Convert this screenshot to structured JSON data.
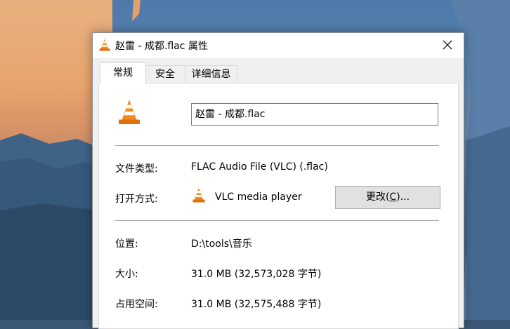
{
  "window": {
    "title": "赵雷 - 成都.flac 属性",
    "close_glyph": "✕"
  },
  "tabs": [
    {
      "label": "常规",
      "active": true
    },
    {
      "label": "安全",
      "active": false
    },
    {
      "label": "详细信息",
      "active": false
    }
  ],
  "general": {
    "file_name": "赵雷 - 成都.flac",
    "file_type_label": "文件类型:",
    "file_type_value": "FLAC Audio File (VLC) (.flac)",
    "opens_with_label": "打开方式:",
    "opens_with_value": "VLC media player",
    "change_button": {
      "before": "更改(",
      "hotkey": "C",
      "after": ")..."
    },
    "location_label": "位置:",
    "location_value": "D:\\tools\\音乐",
    "size_label": "大小:",
    "size_value": "31.0 MB (32,573,028 字节)",
    "size_on_disk_label": "占用空间:",
    "size_on_disk_value": "31.0 MB (32,575,488 字节)"
  },
  "icons": {
    "app_icon": "vlc-cone-icon",
    "close_icon": "close-icon"
  },
  "colors": {
    "vlc_orange": "#f28c1c",
    "button_face": "#e1e1e1",
    "dialog_background": "#f0f0f0"
  }
}
